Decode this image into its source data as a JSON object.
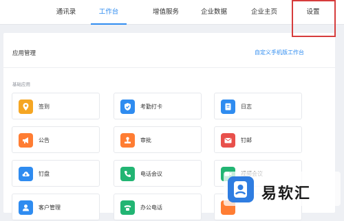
{
  "nav": {
    "tabs": [
      "通讯录",
      "工作台",
      "增值服务",
      "企业数据",
      "企业主页",
      "设置"
    ],
    "active_tab": "工作台"
  },
  "app_management": {
    "title": "应用管理",
    "custom_link": "自定义手机版工作台",
    "section_label": "基础应用",
    "apps": [
      {
        "label": "签到",
        "icon": "location-pin-icon",
        "color": "#f5a623"
      },
      {
        "label": "考勤打卡",
        "icon": "shield-check-icon",
        "color": "#2f8cf0"
      },
      {
        "label": "日志",
        "icon": "notebook-icon",
        "color": "#2f8cf0"
      },
      {
        "label": "公告",
        "icon": "megaphone-icon",
        "color": "#ff7d33"
      },
      {
        "label": "审批",
        "icon": "stamp-icon",
        "color": "#ff7d33"
      },
      {
        "label": "钉邮",
        "icon": "mail-icon",
        "color": "#e8504b"
      },
      {
        "label": "钉盘",
        "icon": "cloud-disk-icon",
        "color": "#2f8cf0"
      },
      {
        "label": "电话会议",
        "icon": "phone-icon",
        "color": "#22b573"
      },
      {
        "label": "视频会议",
        "icon": "video-icon",
        "color": "#22b573"
      },
      {
        "label": "客户管理",
        "icon": "user-icon",
        "color": "#2f8cf0"
      },
      {
        "label": "办公电话",
        "icon": "telephone-icon",
        "color": "#22b573"
      },
      {
        "label": "",
        "icon": "app-icon",
        "color": "#ff7d33"
      }
    ]
  },
  "watermark": {
    "text": "易软汇"
  }
}
